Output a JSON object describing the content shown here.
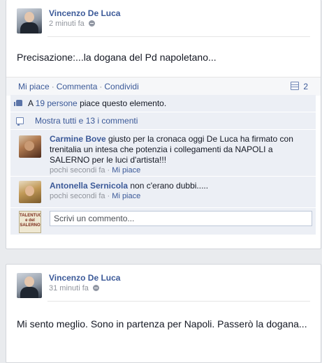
{
  "posts": [
    {
      "author": "Vincenzo De Luca",
      "time": "2 minuti fa",
      "text": "Precisazione:...la dogana del Pd napoletano...",
      "actions": {
        "like": "Mi piace",
        "comment": "Commenta",
        "share": "Condividi"
      },
      "comment_count": "2",
      "likes": {
        "prefix": "A",
        "link": "19 persone",
        "suffix": "piace questo elemento."
      },
      "view_all": "Mostra tutti e 13 i commenti",
      "comments": [
        {
          "author": "Carmine Bove",
          "text": "giusto per la cronaca oggi De Luca ha firmato con trenitalia un intesa che potenzia i collegamenti da NAPOLI a SALERNO per le luci d'artista!!!",
          "time": "pochi secondi fa",
          "like": "Mi piace"
        },
        {
          "author": "Antonella Sernicola",
          "text": "non c'erano dubbi.....",
          "time": "pochi secondi fa",
          "like": "Mi piace"
        }
      ],
      "write_placeholder": "Scrivi un commento...",
      "viewer_avatar_text": "TALENTUOSO e del SALERNO"
    },
    {
      "author": "Vincenzo De Luca",
      "time": "31 minuti fa",
      "text": "Mi sento meglio. Sono in partenza per Napoli. Passerò la dogana..."
    }
  ],
  "icons": [
    "globe-icon",
    "comment-count-icon",
    "thumbs-up-icon",
    "comments-icon"
  ],
  "colors": {
    "link": "#3b5998",
    "meta": "#90949c",
    "ufi_bg": "#eceff5",
    "page_bg": "#e9ebee"
  }
}
